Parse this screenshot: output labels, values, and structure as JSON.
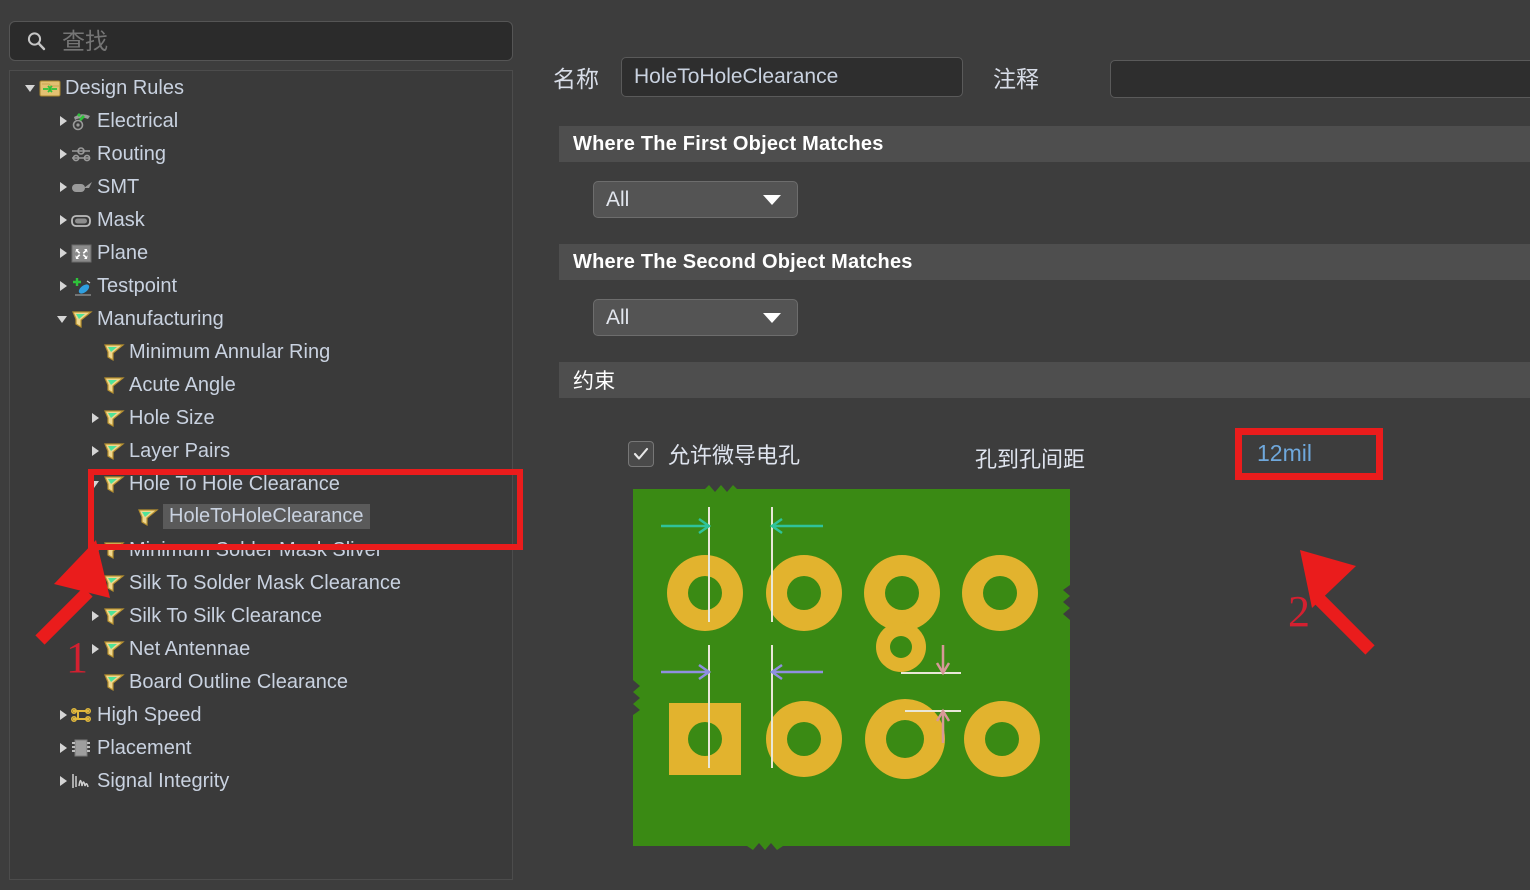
{
  "search": {
    "placeholder": "查找",
    "value": "",
    "icon": "search-icon"
  },
  "tree": {
    "items": [
      {
        "label": "Design Rules",
        "indent": 0,
        "twisty": "open",
        "icon": "folder-rules-icon",
        "selected": false
      },
      {
        "label": "Electrical",
        "indent": 1,
        "twisty": "closed",
        "icon": "electrical-icon",
        "selected": false
      },
      {
        "label": "Routing",
        "indent": 1,
        "twisty": "closed",
        "icon": "routing-icon",
        "selected": false
      },
      {
        "label": "SMT",
        "indent": 1,
        "twisty": "closed",
        "icon": "smt-icon",
        "selected": false
      },
      {
        "label": "Mask",
        "indent": 1,
        "twisty": "closed",
        "icon": "mask-icon",
        "selected": false
      },
      {
        "label": "Plane",
        "indent": 1,
        "twisty": "closed",
        "icon": "plane-icon",
        "selected": false
      },
      {
        "label": "Testpoint",
        "indent": 1,
        "twisty": "closed",
        "icon": "testpoint-icon",
        "selected": false
      },
      {
        "label": "Manufacturing",
        "indent": 1,
        "twisty": "open",
        "icon": "rule-flag-icon",
        "selected": false
      },
      {
        "label": "Minimum Annular Ring",
        "indent": 2,
        "twisty": "none",
        "icon": "rule-flag-icon",
        "selected": false
      },
      {
        "label": "Acute Angle",
        "indent": 2,
        "twisty": "none",
        "icon": "rule-flag-icon",
        "selected": false
      },
      {
        "label": "Hole Size",
        "indent": 2,
        "twisty": "closed",
        "icon": "rule-flag-icon",
        "selected": false
      },
      {
        "label": "Layer Pairs",
        "indent": 2,
        "twisty": "closed",
        "icon": "rule-flag-icon",
        "selected": false
      },
      {
        "label": "Hole To Hole Clearance",
        "indent": 2,
        "twisty": "open",
        "icon": "rule-flag-icon",
        "selected": false
      },
      {
        "label": "HoleToHoleClearance",
        "indent": 3,
        "twisty": "none",
        "icon": "rule-flag-icon",
        "selected": true
      },
      {
        "label": "Minimum Solder Mask Sliver",
        "indent": 2,
        "twisty": "closed",
        "icon": "rule-flag-icon",
        "selected": false
      },
      {
        "label": "Silk To Solder Mask Clearance",
        "indent": 2,
        "twisty": "closed",
        "icon": "rule-flag-icon",
        "selected": false
      },
      {
        "label": "Silk To Silk Clearance",
        "indent": 2,
        "twisty": "closed",
        "icon": "rule-flag-icon",
        "selected": false
      },
      {
        "label": "Net Antennae",
        "indent": 2,
        "twisty": "closed",
        "icon": "rule-flag-icon",
        "selected": false
      },
      {
        "label": "Board Outline Clearance",
        "indent": 2,
        "twisty": "none",
        "icon": "rule-flag-icon",
        "selected": false
      },
      {
        "label": "High Speed",
        "indent": 1,
        "twisty": "closed",
        "icon": "high-speed-icon",
        "selected": false
      },
      {
        "label": "Placement",
        "indent": 1,
        "twisty": "closed",
        "icon": "placement-icon",
        "selected": false
      },
      {
        "label": "Signal Integrity",
        "indent": 1,
        "twisty": "closed",
        "icon": "signal-integrity-icon",
        "selected": false
      }
    ]
  },
  "detail": {
    "name_label": "名称",
    "name_value": "HoleToHoleClearance",
    "comment_label": "注释",
    "comment_value": "",
    "first_object": {
      "header": "Where The First Object Matches",
      "scope_value": "All"
    },
    "second_object": {
      "header": "Where The Second Object Matches",
      "scope_value": "All"
    },
    "constraint": {
      "header": "约束",
      "allow_microvia_label": "允许微导电孔",
      "allow_microvia_checked": true,
      "gap_label": "孔到孔间距",
      "gap_value": "12mil"
    }
  },
  "annotations": {
    "step1": "1",
    "step2": "2",
    "color": "#ea1c1c"
  },
  "colors": {
    "panel_bg": "#3d3d3d",
    "section_header": "#4e4e4e",
    "text": "#c9d2e0",
    "accent_value": "#6fa8dc",
    "pcb_green": "#3a8a14",
    "pcb_pad": "#e2b32e",
    "annotation_red": "#ea1c1c"
  }
}
